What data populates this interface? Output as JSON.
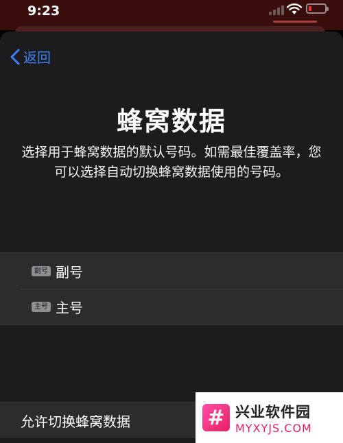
{
  "status": {
    "time": "9:23",
    "signal_icon": "signal-icon",
    "wifi_icon": "wifi-icon",
    "battery_icon": "battery-low-icon",
    "battery_level": 0.1
  },
  "nav": {
    "back_label": "返回"
  },
  "page": {
    "title": "蜂窝数据",
    "description": "选择用于蜂窝数据的默认号码。如需最佳覆盖率，您可以选择自动切换蜂窝数据使用的号码。"
  },
  "lines": [
    {
      "badge": "副号",
      "label": "副号"
    },
    {
      "badge": "主号",
      "label": "主号"
    }
  ],
  "allow_switch": {
    "label": "允许切换蜂窝数据"
  },
  "watermark": {
    "logo_char": "#",
    "name": "兴业软件园",
    "url": "MYXYJS.COM"
  },
  "colors": {
    "accent": "#3b82f6",
    "background": "#1c1c1e",
    "watermark_accent": "#e91e63"
  }
}
